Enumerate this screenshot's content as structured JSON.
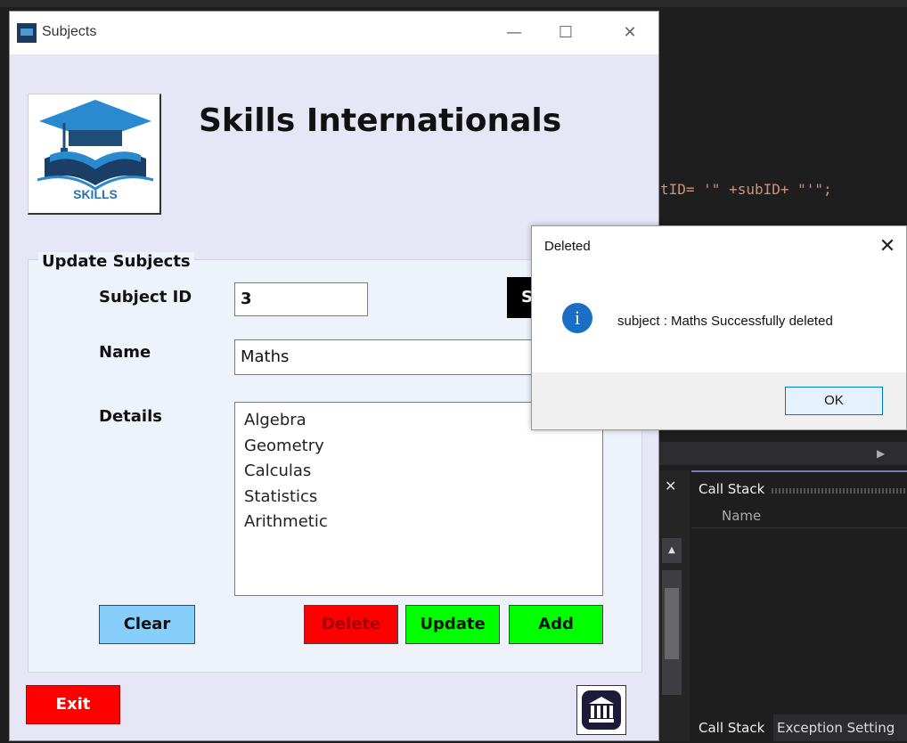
{
  "ide": {
    "code_snippet": "tID= '\" +subID+ \"'\";",
    "call_stack_title": "Call Stack",
    "call_stack_column": "Name",
    "tabs": [
      "Call Stack",
      "Exception Setting"
    ]
  },
  "window": {
    "title": "Subjects",
    "controls": {
      "minimize": "—",
      "maximize": "☐",
      "close": "✕"
    }
  },
  "brand": {
    "logo_text": "SKILLS",
    "name": "Skills Internationals"
  },
  "form": {
    "group_label": "Update Subjects",
    "subject_id_label": "Subject ID",
    "subject_id_value": "3",
    "search_label": "S",
    "name_label": "Name",
    "name_value": "Maths",
    "details_label": "Details",
    "details_lines": [
      "Algebra",
      "Geometry",
      "Calculas",
      "Statistics",
      "Arithmetic"
    ]
  },
  "buttons": {
    "clear": "Clear",
    "delete": "Delete",
    "update": "Update",
    "add": "Add",
    "exit": "Exit"
  },
  "dialog": {
    "title": "Deleted",
    "close": "✕",
    "message": "subject : Maths Successfully deleted",
    "ok": "OK",
    "icon": "info-icon"
  },
  "colors": {
    "clear_bg": "#87cefa",
    "delete_bg": "#ff0000",
    "update_bg": "#00ff00",
    "add_bg": "#00ff00",
    "exit_bg": "#ff0000",
    "window_bg": "#e6e6f7"
  }
}
